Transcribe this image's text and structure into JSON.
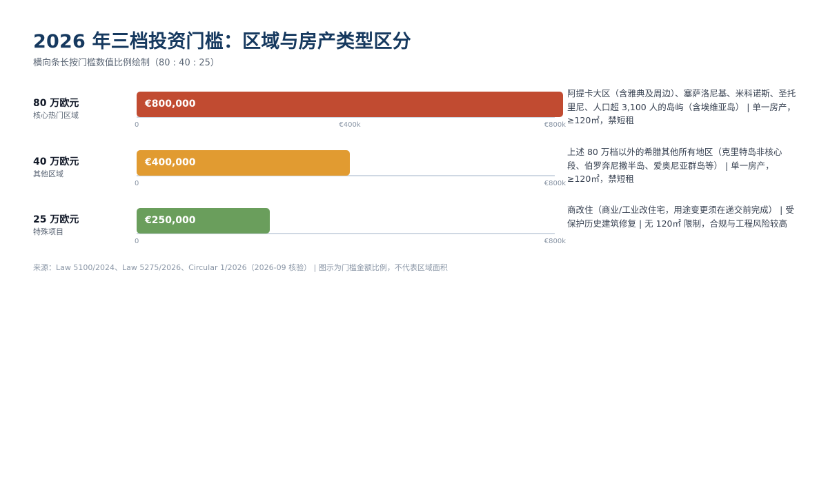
{
  "title": "2026 年三档投资门槛：区域与房产类型区分",
  "subtitle": "横向条长按门槛数值比例绘制（80 : 40 : 25）",
  "footer": "来源：Law 5100/2024、Law 5275/2026、Circular 1/2026（2026-09 核验） | 图示为门槛金额比例，不代表区域面积",
  "chart_data": {
    "type": "bar",
    "orientation": "horizontal",
    "title": "2026 年三档投资门槛：区域与房产类型区分",
    "subtitle": "横向条长按门槛数值比例绘制（80 : 40 : 25）",
    "xlim": [
      0,
      800000
    ],
    "grid": false,
    "categories": [
      "80 万欧元",
      "40 万欧元",
      "25 万欧元"
    ],
    "values": [
      800000,
      400000,
      250000
    ],
    "tiers": [
      {
        "amount_label": "80 万欧元",
        "region": "核心热门区域",
        "value": 800000,
        "value_label": "€800,000",
        "color": "#c14b31",
        "ticks": [
          "0",
          "€400k",
          "€800k"
        ],
        "tick_values": [
          0,
          400000,
          800000
        ],
        "description": "阿提卡大区（含雅典及周边）、塞萨洛尼基、米科诺斯、圣托里尼、人口超 3,100 人的岛屿（含埃维亚岛） | 单一房产，≥120㎡，禁短租"
      },
      {
        "amount_label": "40 万欧元",
        "region": "其他区域",
        "value": 400000,
        "value_label": "€400,000",
        "color": "#e19b31",
        "ticks": [
          "0",
          "€800k"
        ],
        "tick_values": [
          0,
          800000
        ],
        "description": "上述 80 万档以外的希腊其他所有地区（克里特岛非核心段、伯罗奔尼撒半岛、爱奥尼亚群岛等） | 单一房产，≥120㎡，禁短租"
      },
      {
        "amount_label": "25 万欧元",
        "region": "特殊项目",
        "value": 250000,
        "value_label": "€250,000",
        "color": "#6a9e5c",
        "ticks": [
          "0",
          "€800k"
        ],
        "tick_values": [
          0,
          800000
        ],
        "description": "商改住（商业/工业改住宅，用途变更须在递交前完成） | 受保护历史建筑修复 | 无 120㎡ 限制，合规与工程风险较高"
      }
    ]
  }
}
